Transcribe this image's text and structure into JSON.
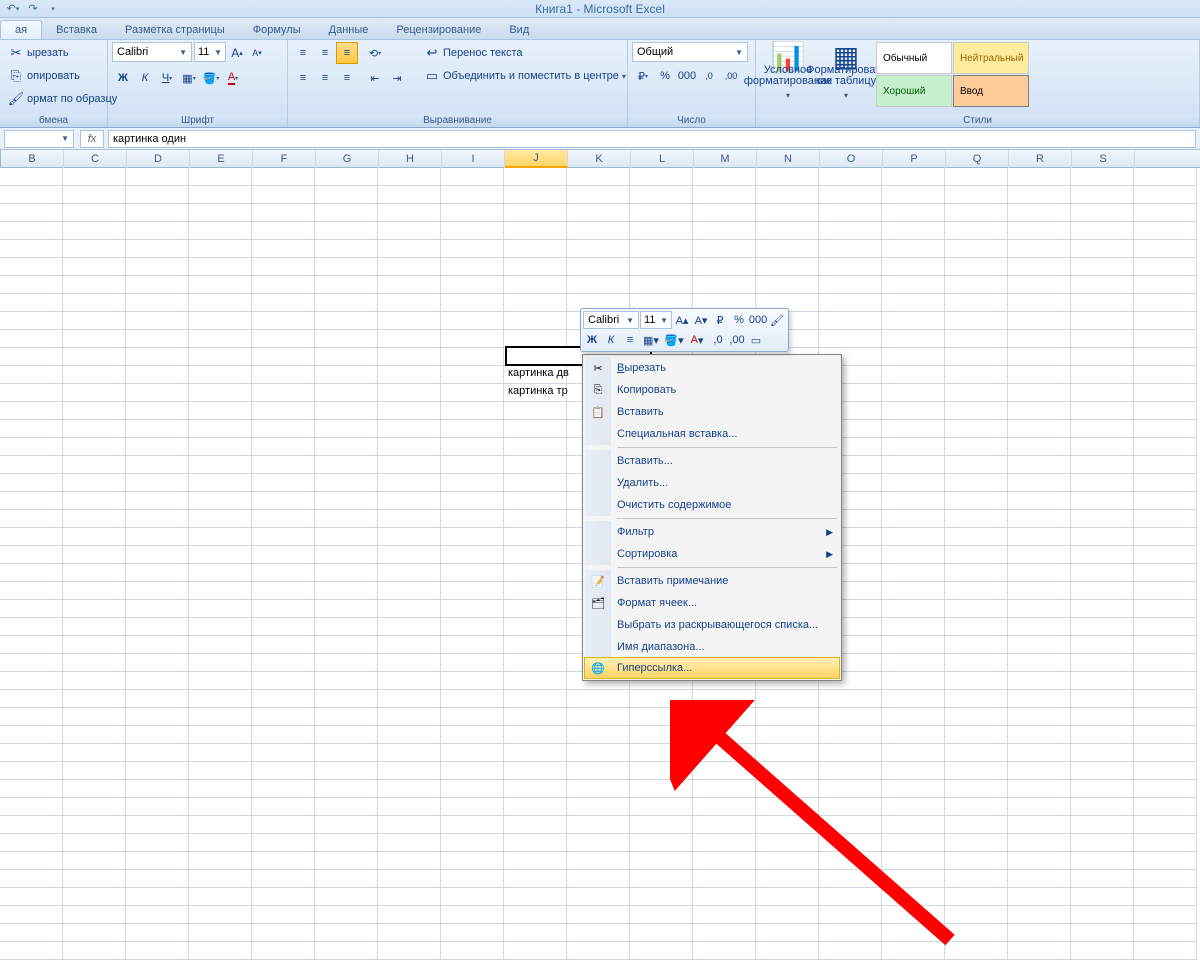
{
  "title": "Книга1 - Microsoft Excel",
  "tabs": [
    "ая",
    "Вставка",
    "Разметка страницы",
    "Формулы",
    "Данные",
    "Рецензирование",
    "Вид"
  ],
  "clipboard": {
    "cut": "ырезать",
    "copy": "опировать",
    "format": "ормат по образцу",
    "label": "бмена"
  },
  "font": {
    "name": "Calibri",
    "size": "11",
    "label": "Шрифт"
  },
  "align": {
    "wrap": "Перенос текста",
    "merge": "Объединить и поместить в центре",
    "label": "Выравнивание"
  },
  "number": {
    "format": "Общий",
    "label": "Число"
  },
  "styles": {
    "cond": "Условное форматирование",
    "table": "Форматировать как таблицу",
    "s1": "Обычный",
    "s2": "Нейтральный",
    "s3": "Хороший",
    "s4": "Ввод",
    "label": "Стили"
  },
  "formula": {
    "value": "картинка один"
  },
  "columns": [
    "B",
    "C",
    "D",
    "E",
    "F",
    "G",
    "H",
    "I",
    "J",
    "K",
    "L",
    "M",
    "N",
    "O",
    "P",
    "Q",
    "R",
    "S"
  ],
  "cells": {
    "j11": "картинка один",
    "j12": "картинка дв",
    "j13": "картинка тр"
  },
  "mini": {
    "font": "Calibri",
    "size": "11"
  },
  "ctx": {
    "cut": "Вырезать",
    "copy": "Копировать",
    "paste": "Вставить",
    "pastespecial": "Специальная вставка...",
    "insert": "Вставить...",
    "delete": "Удалить...",
    "clear": "Очистить содержимое",
    "filter": "Фильтр",
    "sort": "Сортировка",
    "comment": "Вставить примечание",
    "format": "Формат ячеек...",
    "dropdown": "Выбрать из раскрывающегося списка...",
    "name": "Имя диапазона...",
    "hyperlink": "Гиперссылка..."
  }
}
